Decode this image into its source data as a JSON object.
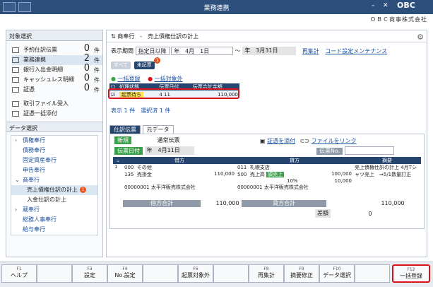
{
  "window": {
    "title": "業務連携",
    "logo": "OBC",
    "company": "ＯＢＣ商事株式会社"
  },
  "left": {
    "header": "対象選択",
    "items": [
      {
        "label": "予約仕訳伝票",
        "count": "0",
        "unit": "件",
        "icon": "calendar-icon"
      },
      {
        "label": "業務連携",
        "count": "2",
        "unit": "件",
        "icon": "sync-icon"
      },
      {
        "label": "銀行入出金明細",
        "count": "0",
        "unit": "件",
        "icon": "bank-icon"
      },
      {
        "label": "キャッシュレス明細",
        "count": "0",
        "unit": "件",
        "icon": "card-icon"
      },
      {
        "label": "証憑",
        "count": "0",
        "unit": "件",
        "icon": "document-icon"
      }
    ],
    "links": [
      {
        "label": "取引ファイル受入",
        "icon": "import-icon"
      },
      {
        "label": "証憑一括添付",
        "icon": "attach-icon"
      }
    ],
    "data_header": "データ選択",
    "tree": [
      {
        "label": "債権奉行",
        "type": "parent"
      },
      {
        "label": "債務奉行",
        "type": "leaf"
      },
      {
        "label": "固定資産奉行",
        "type": "leaf"
      },
      {
        "label": "申告奉行",
        "type": "leaf"
      },
      {
        "label": "商奉行",
        "type": "parent"
      },
      {
        "label": "売上債権仕訳の計上",
        "type": "child",
        "badge": "1"
      },
      {
        "label": "入金仕訳の計上",
        "type": "child"
      },
      {
        "label": "蔵奉行",
        "type": "parent"
      },
      {
        "label": "総務人事奉行",
        "type": "leaf"
      },
      {
        "label": "給与奉行",
        "type": "leaf"
      }
    ]
  },
  "main": {
    "title": "商奉行　-　売上債権仕訳の計上",
    "period_label": "表示期間",
    "period_value": "指定日以降",
    "date_from": "年　4月　1日",
    "tilde": "～",
    "date_to": "年　3月31日",
    "recalc": "再集計",
    "code_maint": "コード設定メンテナンス",
    "chip_all": "すべて",
    "chip_unposted": "未記票",
    "chip_badge": "1",
    "bulk_register": "一括登録",
    "bulk_exclude": "一括対象外",
    "grid_headers": [
      "処理状態",
      "伝票日付",
      "伝票合計金額"
    ],
    "row": {
      "status": "起票待ち",
      "date": "4  11",
      "amount": "110,000"
    },
    "summary": "表示 1 件　選択済 1 件"
  },
  "slip": {
    "tabs": [
      "仕訳伝票",
      "元データ"
    ],
    "new_label": "新規",
    "slip_type": "通常伝票",
    "date_label": "伝票日付",
    "date_value": "年　4月11日",
    "attach": "証憑を添付",
    "file_link": "ファイルをリンク",
    "slip_no": "伝票No.",
    "headers": [
      "借方",
      "貸方",
      "摘要"
    ],
    "debit": {
      "code": "000",
      "name": "その他",
      "acct": "135",
      "acct_name": "売掛金",
      "amount": "110,000",
      "partner": "00000001",
      "partner_name": "太平洋販売株式会社"
    },
    "credit": {
      "code": "011",
      "name": "札幌支店",
      "acct": "500",
      "acct_name": "売上高",
      "tax": "課売上",
      "amount": "100,000",
      "rate": "10%",
      "tax_amount": "10,000",
      "partner": "00000001",
      "partner_name": "太平洋販売株式会社"
    },
    "memo": "売上債権仕訳の計上 4月Tシャツ売上　⇒5/1数量訂正",
    "debit_total_label": "借方合計",
    "debit_total": "110,000",
    "credit_total_label": "貸方合計",
    "credit_total": "110,000",
    "diff_label": "差額",
    "diff": "0"
  },
  "fkeys": [
    {
      "key": "F1",
      "label": "ヘルプ"
    },
    {
      "key": "",
      "label": ""
    },
    {
      "key": "F3",
      "label": "設定"
    },
    {
      "key": "F4",
      "label": "No.設定"
    },
    {
      "key": "",
      "label": ""
    },
    {
      "key": "F6",
      "label": "起票対象外"
    },
    {
      "key": "",
      "label": ""
    },
    {
      "key": "F8",
      "label": "再集計"
    },
    {
      "key": "F9",
      "label": "摘要修正"
    },
    {
      "key": "F10",
      "label": "データ選択"
    },
    {
      "key": "",
      "label": ""
    },
    {
      "key": "F12",
      "label": "一括登録"
    }
  ]
}
